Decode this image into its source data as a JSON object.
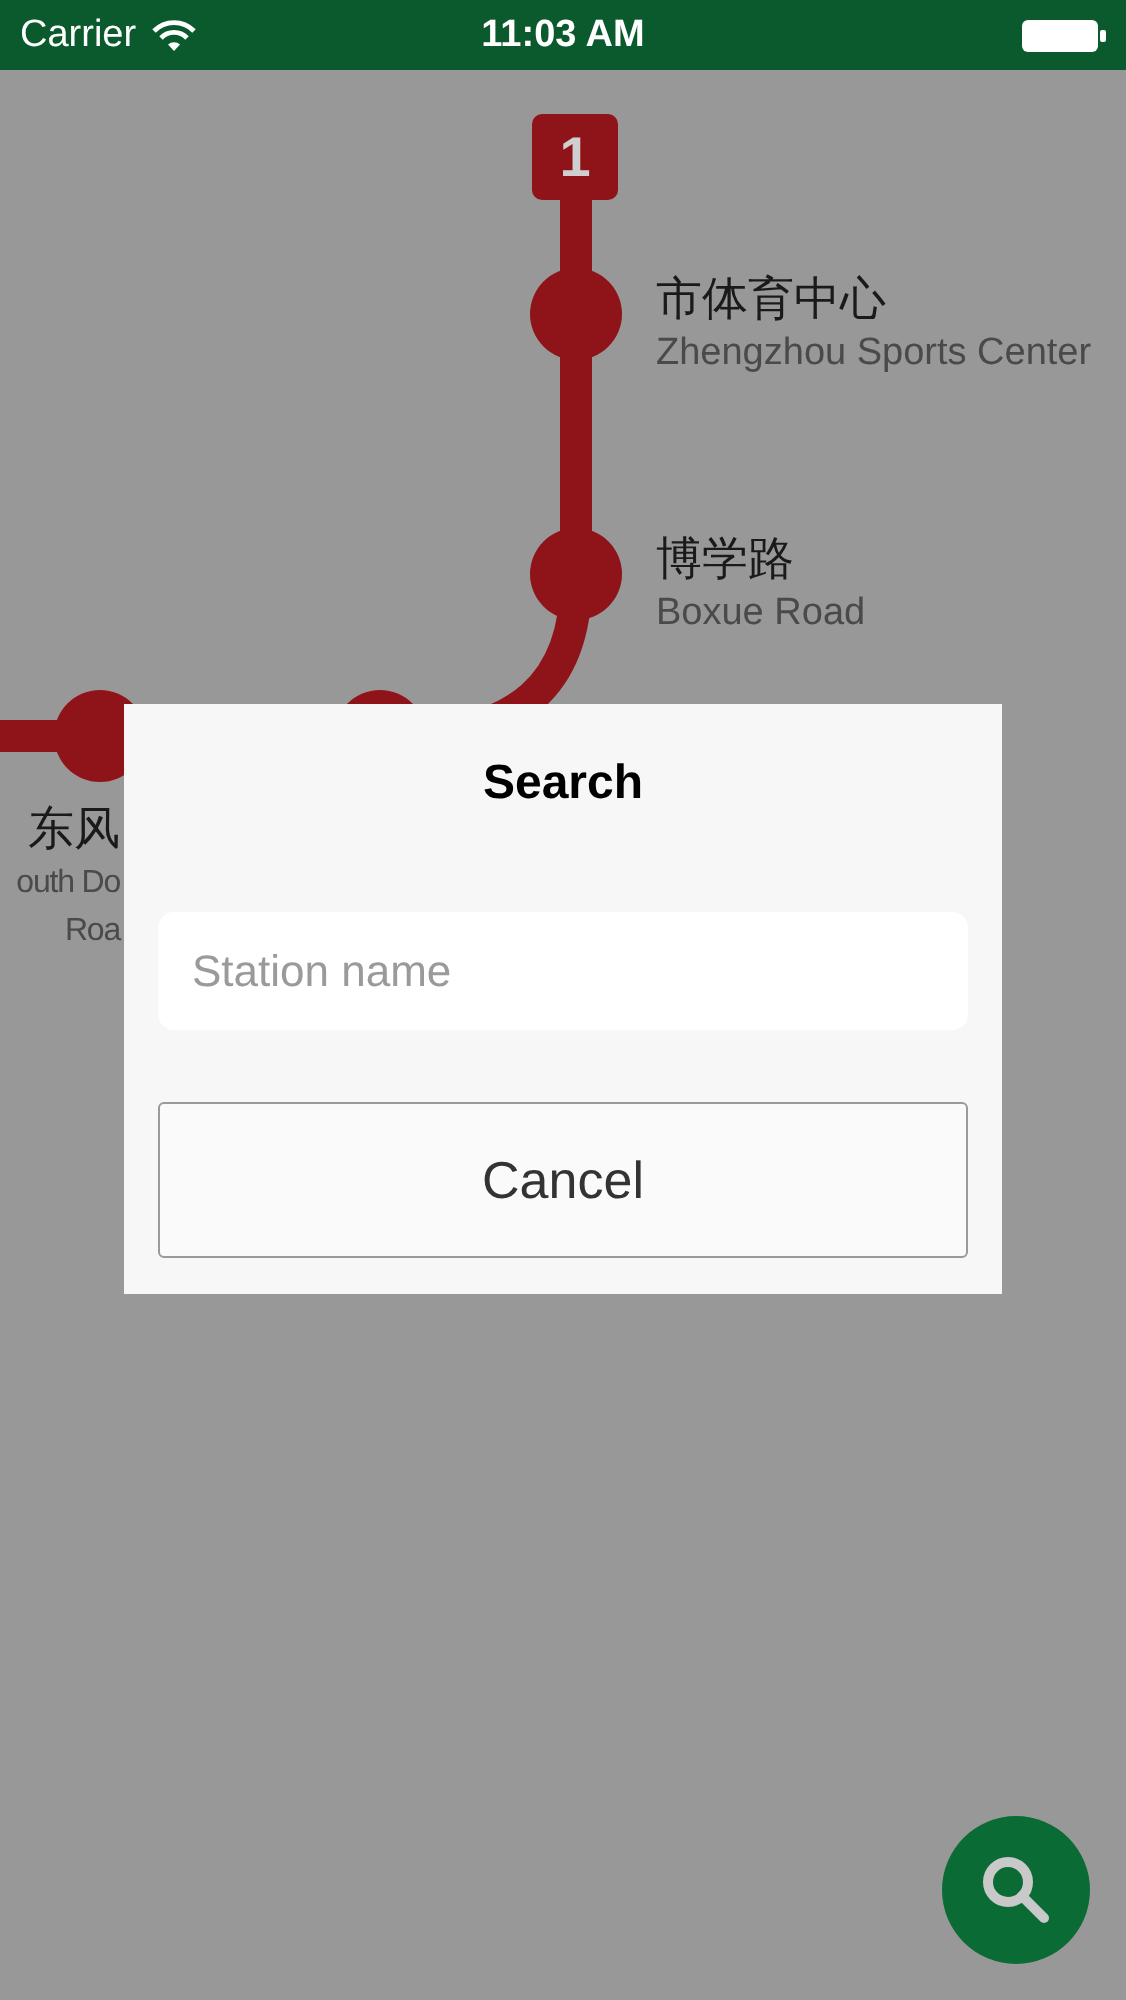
{
  "status_bar": {
    "carrier": "Carrier",
    "time": "11:03 AM"
  },
  "map": {
    "line_badge": "1",
    "stations": [
      {
        "name": "市体育中心",
        "english": [
          "Zhengzhou Sports Center"
        ]
      },
      {
        "name": "博学路",
        "english": [
          "Boxue Road"
        ]
      },
      {
        "name": "东风",
        "english": [
          "outh Do",
          "Roa"
        ]
      }
    ]
  },
  "dialog": {
    "title": "Search",
    "search": {
      "placeholder": "Station name"
    },
    "cancel": "Cancel"
  }
}
